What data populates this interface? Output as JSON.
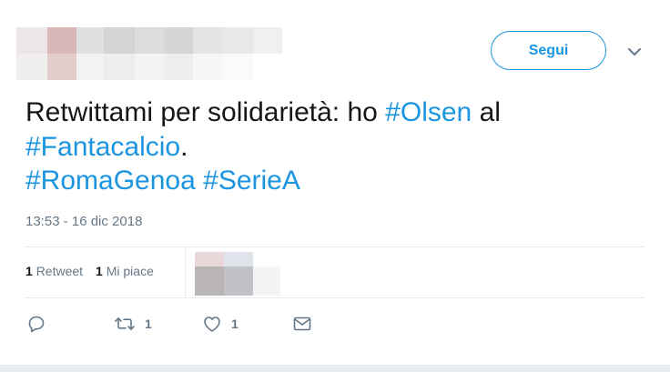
{
  "header": {
    "follow_label": "Segui"
  },
  "tweet": {
    "text_parts": {
      "line1_plain1": "Retwittami per solidarietà: ho ",
      "tag_olsen": "#Olsen",
      "line1_plain2": " al",
      "tag_fantacalcio": "#Fantacalcio",
      "line2_plain": ".",
      "tag_romagenoa": "#RomaGenoa",
      "tag_seriea": "#SerieA"
    },
    "timestamp": "13:53 - 16 dic 2018"
  },
  "stats": {
    "retweets_count": "1",
    "retweets_label": "Retweet",
    "likes_count": "1",
    "likes_label": "Mi piace"
  },
  "actions": {
    "reply_icon": "reply-icon",
    "retweet_icon": "retweet-icon",
    "retweet_count": "1",
    "like_icon": "heart-icon",
    "like_count": "1",
    "dm_icon": "envelope-icon"
  },
  "colors": {
    "accent": "#1b95e0",
    "text": "#14171a",
    "muted": "#657786",
    "divider": "#e6ecf0"
  }
}
